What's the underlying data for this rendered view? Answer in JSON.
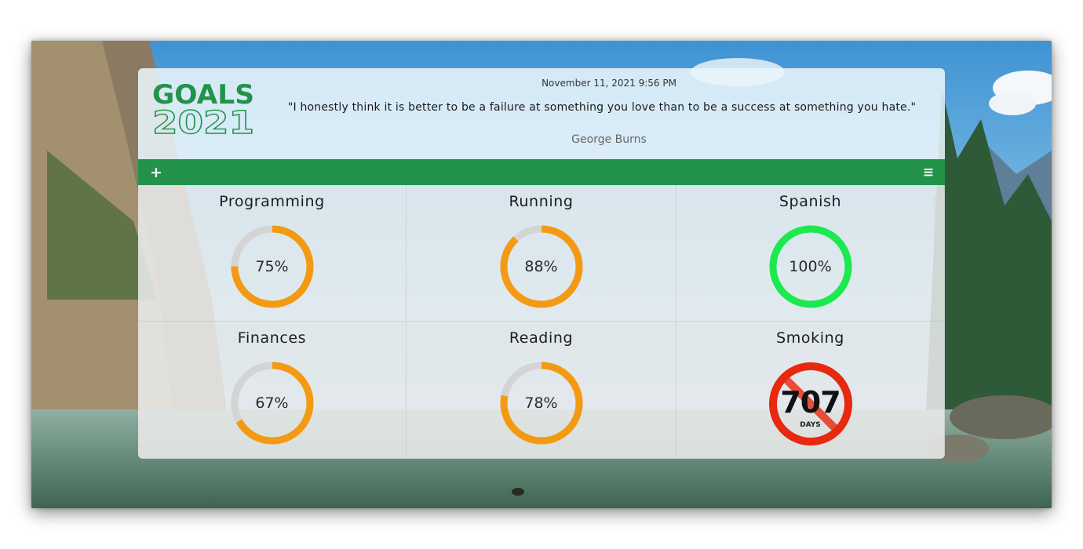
{
  "header": {
    "logo_line1": "GOALS",
    "logo_line2": "2021",
    "datetime": "November 11, 2021 9:56 PM",
    "quote": "\"I honestly think it is better to be a failure at something you love than to be a success at something you hate.\"",
    "author": "George Burns"
  },
  "toolbar": {
    "add_icon": "plus-icon",
    "add_glyph": "+",
    "menu_icon": "hamburger-menu-icon",
    "menu_glyph": "≡",
    "color": "#23924a"
  },
  "goals": [
    {
      "title": "Programming",
      "label": "75%",
      "progress": 0.75,
      "color": "#f39a12"
    },
    {
      "title": "Running",
      "label": "88%",
      "progress": 0.88,
      "color": "#f39a12"
    },
    {
      "title": "Spanish",
      "label": "100%",
      "progress": 1.0,
      "color": "#1de84f"
    },
    {
      "title": "Finances",
      "label": "67%",
      "progress": 0.67,
      "color": "#f39a12"
    },
    {
      "title": "Reading",
      "label": "78%",
      "progress": 0.78,
      "color": "#f39a12"
    },
    {
      "title": "Smoking",
      "count": "707",
      "unit": "DAYS",
      "icon": "no-smoking-icon",
      "color": "#e8280f"
    }
  ],
  "colors": {
    "ring_track": "#d4d4d4",
    "in_progress": "#f39a12",
    "complete": "#1de84f",
    "logo_green": "#23924a"
  }
}
